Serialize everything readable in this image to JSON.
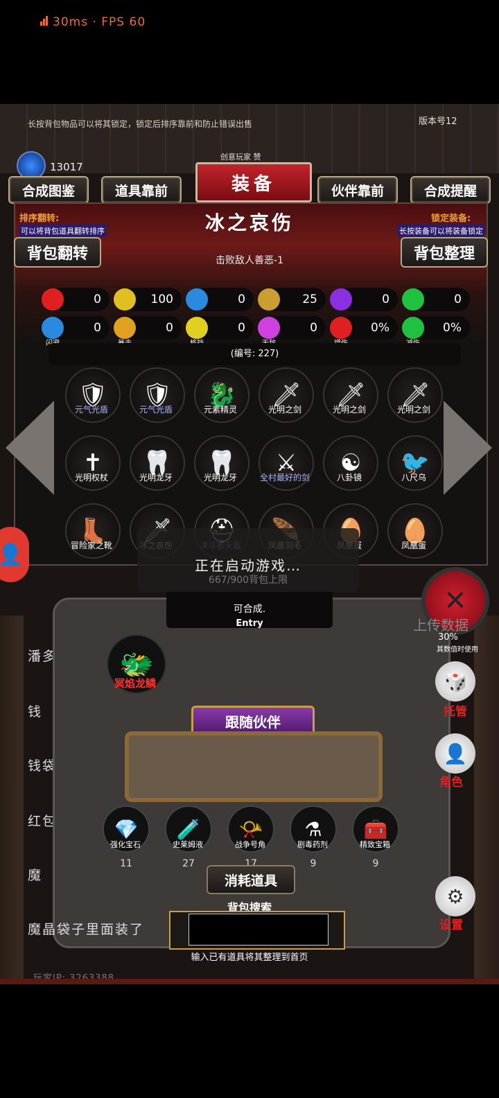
{
  "status": {
    "latency": "30ms",
    "separator": "·",
    "fps": "FPS 60"
  },
  "header": {
    "notice": "长按背包物品可以将其锁定，锁定后排序靠前和防止错误出售",
    "version": "版本号12",
    "currency": "13017",
    "title": "装备",
    "subtitle": "创意玩家 赞"
  },
  "tabs": {
    "synth_book": "合成图鉴",
    "items_front": "道具靠前",
    "partner_front": "伙伴靠前",
    "synth_hint": "合成提醒"
  },
  "panel": {
    "sort_title": "排序翻转:",
    "sort_desc": "可以将背包道具翻转排序",
    "lock_title": "锁定装备:",
    "lock_desc": "长按装备可以将装备锁定",
    "flip_button": "背包翻转",
    "organize_button": "背包整理",
    "item_name": "冰之哀伤",
    "item_effect": "击败敌人善恶-1",
    "serial": "(编号: 227)"
  },
  "stats_row1": [
    {
      "icon": "heart-icon",
      "value": "0",
      "color": "#e02020"
    },
    {
      "icon": "strength-icon",
      "value": "100",
      "color": "#e0c020"
    },
    {
      "icon": "helmet-icon",
      "value": "0",
      "color": "#2a8ae0"
    },
    {
      "icon": "sword-icon",
      "value": "25",
      "color": "#c9a030"
    },
    {
      "icon": "lightning-icon",
      "value": "0",
      "color": "#8a30e0"
    },
    {
      "icon": "clover-icon",
      "value": "0",
      "color": "#20c040"
    }
  ],
  "stats_row2": [
    {
      "icon": "boot-icon",
      "value": "0",
      "label": "闪避",
      "color": "#2a8ae0"
    },
    {
      "icon": "crit-icon",
      "value": "0",
      "label": "暴击",
      "color": "#e0a020"
    },
    {
      "icon": "shield-icon",
      "value": "0",
      "label": "格挡",
      "color": "#e0d020"
    },
    {
      "icon": "wings-icon",
      "value": "0",
      "label": "无敌",
      "color": "#d040e0"
    },
    {
      "icon": "damage-up-icon",
      "value": "0%",
      "label": "增伤",
      "color": "#e02020"
    },
    {
      "icon": "damage-down-icon",
      "value": "0%",
      "label": "减伤",
      "color": "#20c040"
    }
  ],
  "inventory": [
    {
      "name": "元气光盾",
      "icon": "🛡",
      "color": "#a8b0ff"
    },
    {
      "name": "元气光盾",
      "icon": "🛡",
      "color": "#a8b0ff"
    },
    {
      "name": "元素精灵",
      "icon": "🐉",
      "color": "#ffffff"
    },
    {
      "name": "光明之剑",
      "icon": "🗡",
      "color": "#ffffff"
    },
    {
      "name": "光明之剑",
      "icon": "🗡",
      "color": "#ffffff"
    },
    {
      "name": "光明之剑",
      "icon": "🗡",
      "color": "#ffffff"
    },
    {
      "name": "光明权杖",
      "icon": "✝",
      "color": "#ffffff"
    },
    {
      "name": "光明龙牙",
      "icon": "🦷",
      "color": "#ffffff"
    },
    {
      "name": "光明龙牙",
      "icon": "🦷",
      "color": "#ffffff"
    },
    {
      "name": "全村最好的剑",
      "icon": "⚔",
      "color": "#a8b0ff"
    },
    {
      "name": "八卦镜",
      "icon": "☯",
      "color": "#ffffff"
    },
    {
      "name": "八尺乌",
      "icon": "🐦",
      "color": "#ffffff"
    },
    {
      "name": "冒险家之靴",
      "icon": "👢",
      "color": "#ffffff"
    },
    {
      "name": "冰之哀伤",
      "icon": "🗡",
      "color": "#ffffff"
    },
    {
      "name": "决斗者头盔",
      "icon": "⛑",
      "color": "#a8b0ff"
    },
    {
      "name": "凤凰羽毛",
      "icon": "🪶",
      "color": "#ffffff"
    },
    {
      "name": "凤凰蛋",
      "icon": "🥚",
      "color": "#ffffff"
    },
    {
      "name": "凤凰蛋",
      "icon": "🥚",
      "color": "#ffffff"
    }
  ],
  "toast": {
    "message": "正在启动游戏…",
    "capacity": "667/900背包上限"
  },
  "lower": {
    "craft_text": "可合成.",
    "entry": "Entry",
    "pet_name": "冥焰龙鳞",
    "follow_button": "跟随伙伴",
    "consumables_title": "消耗道具",
    "search_title": "背包搜索",
    "search_placeholder": "",
    "search_hint": "输入已有道具将其整理到首页",
    "ip": "玩家IP: 3263388"
  },
  "consumables": [
    {
      "name": "强化宝石",
      "count": "11",
      "icon": "💎"
    },
    {
      "name": "史莱姆液",
      "count": "27",
      "icon": "🧪"
    },
    {
      "name": "战争号角",
      "count": "17",
      "icon": "📯"
    },
    {
      "name": "剧毒药剂",
      "count": "9",
      "icon": "⚗"
    },
    {
      "name": "精致宝箱",
      "count": "9",
      "icon": "🧰"
    }
  ],
  "side_labels": [
    "潘多",
    "钱",
    "钱袋子",
    "红包",
    "魔",
    "魔晶袋子里面装了"
  ],
  "right_panel": {
    "upload": "上传数据",
    "percent": "30%",
    "percent_note": "其数值时使用",
    "steward": "托管",
    "role": "角色",
    "settings": "设置"
  }
}
